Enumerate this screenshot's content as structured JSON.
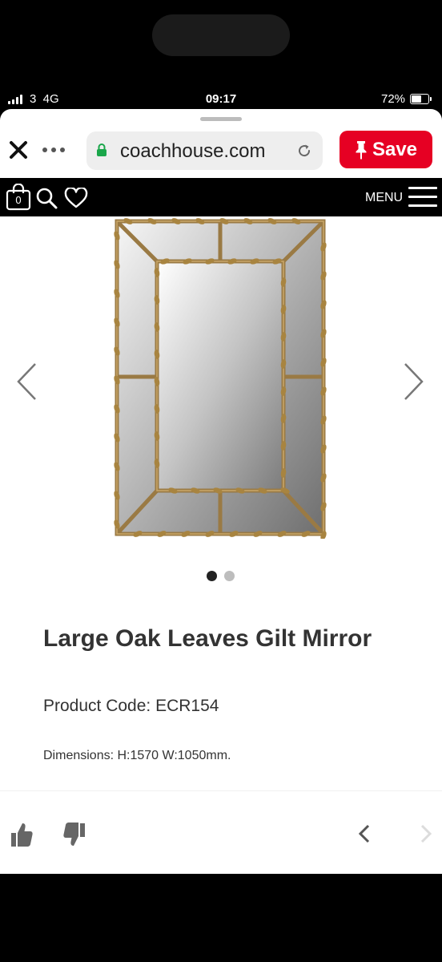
{
  "status_bar": {
    "carrier": "3  4G",
    "time": "09:17",
    "battery_percent": "72%",
    "battery_level": 0.72
  },
  "browser": {
    "url": "coachhouse.com",
    "save_label": "Save",
    "accent_color": "#e60023",
    "icons": [
      "close-icon",
      "more-options-icon",
      "lock-icon",
      "reload-icon",
      "pin-icon"
    ]
  },
  "site_nav": {
    "bag_count": "0",
    "menu_label": "MENU",
    "icons": [
      "shopping-bag-icon",
      "search-icon",
      "heart-icon",
      "hamburger-menu-icon"
    ]
  },
  "gallery": {
    "image_alt": "Gilt mirror with oak leaf frame",
    "total_images": 2,
    "active_index": 0,
    "icons": [
      "chevron-left-icon",
      "chevron-right-icon"
    ]
  },
  "product": {
    "title": "Large Oak Leaves Gilt Mirror",
    "code": "Product Code: ECR154",
    "dimensions": "Dimensions: H:1570 W:1050mm."
  },
  "bottom_toolbar": {
    "icons": [
      "thumbs-up-icon",
      "thumbs-down-icon",
      "back-arrow-icon",
      "forward-arrow-icon"
    ]
  }
}
